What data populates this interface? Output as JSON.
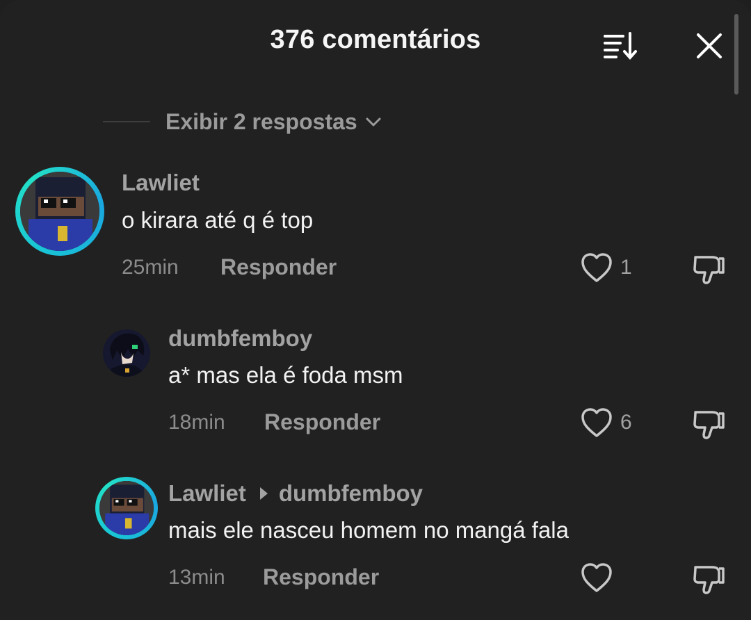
{
  "header": {
    "title": "376 comentários"
  },
  "replies_toggle": {
    "label": "Exibir 2 respostas"
  },
  "comments": [
    {
      "username": "Lawliet",
      "text": "o kirara até q é top",
      "time": "25min",
      "reply_label": "Responder",
      "likes": "1"
    },
    {
      "username": "dumbfemboy",
      "text": "a* mas ela é foda msm",
      "time": "18min",
      "reply_label": "Responder",
      "likes": "6"
    },
    {
      "username": "Lawliet",
      "reply_to": "dumbfemboy",
      "text": "mais ele nasceu homem no mangá fala",
      "time": "13min",
      "reply_label": "Responder",
      "likes": ""
    }
  ],
  "icons": {
    "sort": "sort-icon",
    "close": "close-icon",
    "heart": "heart-icon",
    "dislike": "thumbs-down-icon",
    "chevron": "chevron-down-icon"
  },
  "colors": {
    "background": "#212121",
    "ring": "#19c4d6"
  }
}
